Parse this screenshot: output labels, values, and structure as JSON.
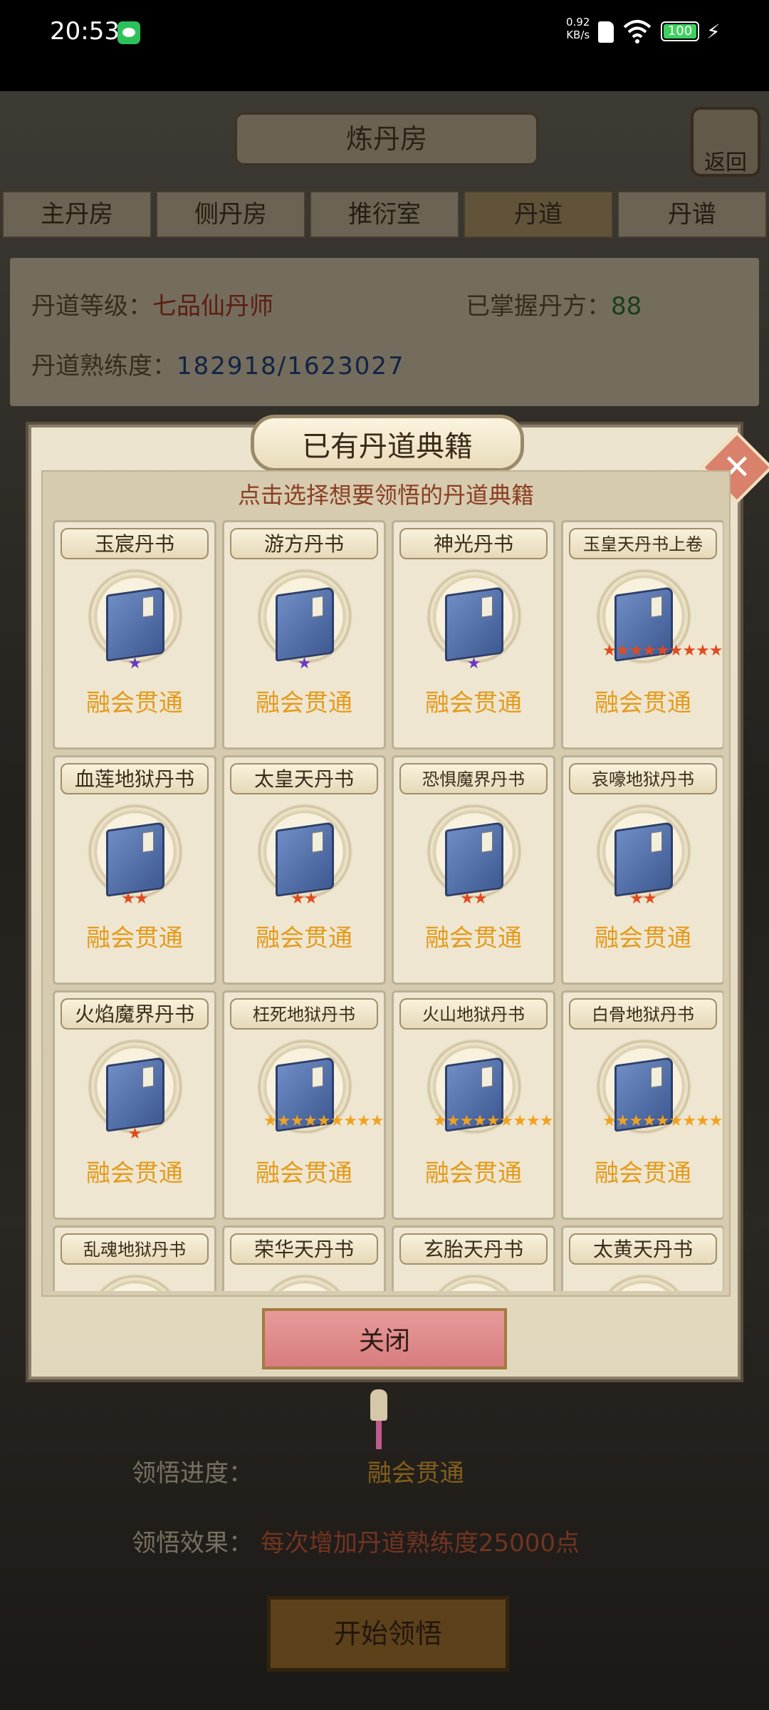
{
  "status_bar": {
    "time": "20:53",
    "net_speed_value": "0.92",
    "net_speed_unit": "KB/s",
    "battery": "100"
  },
  "background": {
    "title": "炼丹房",
    "back_label": "返回",
    "tabs": [
      {
        "label": "主丹房",
        "active": false
      },
      {
        "label": "侧丹房",
        "active": false
      },
      {
        "label": "推衍室",
        "active": false
      },
      {
        "label": "丹道",
        "active": true
      },
      {
        "label": "丹谱",
        "active": false
      }
    ],
    "info": {
      "level_label": "丹道等级：",
      "level_value": "七品仙丹师",
      "mastered_label": "已掌握丹方：",
      "mastered_value": "88",
      "proficiency_label": "丹道熟练度：",
      "proficiency_value": "182918/1623027"
    },
    "progress_label": "领悟进度：",
    "progress_value": "融会贯通",
    "effect_label": "领悟效果：",
    "effect_value": "每次增加丹道熟练度25000点",
    "start_button": "开始领悟"
  },
  "dialog": {
    "title": "已有丹道典籍",
    "subtitle": "点击选择想要领悟的丹道典籍",
    "close_button": "关闭",
    "books": [
      {
        "name": "玉宸丹书",
        "stars": "★",
        "star_color": "purple",
        "status": "融会贯通"
      },
      {
        "name": "游方丹书",
        "stars": "★",
        "star_color": "purple",
        "status": "融会贯通"
      },
      {
        "name": "神光丹书",
        "stars": "★",
        "star_color": "purple",
        "status": "融会贯通"
      },
      {
        "name": "玉皇天丹书上卷",
        "stars": "★★★★★★★★★",
        "star_color": "red",
        "status": "融会贯通"
      },
      {
        "name": "血莲地狱丹书",
        "stars": "★★",
        "star_color": "red",
        "status": "融会贯通"
      },
      {
        "name": "太皇天丹书",
        "stars": "★★",
        "star_color": "red",
        "status": "融会贯通"
      },
      {
        "name": "恐惧魔界丹书",
        "stars": "★★",
        "star_color": "red",
        "status": "融会贯通"
      },
      {
        "name": "哀嚎地狱丹书",
        "stars": "★★",
        "star_color": "red",
        "status": "融会贯通"
      },
      {
        "name": "火焰魔界丹书",
        "stars": "★",
        "star_color": "red",
        "status": "融会贯通"
      },
      {
        "name": "枉死地狱丹书",
        "stars": "★★★★★★★★★",
        "star_color": "gold",
        "status": "融会贯通"
      },
      {
        "name": "火山地狱丹书",
        "stars": "★★★★★★★★★",
        "star_color": "gold",
        "status": "融会贯通"
      },
      {
        "name": "白骨地狱丹书",
        "stars": "★★★★★★★★★",
        "star_color": "gold",
        "status": "融会贯通"
      },
      {
        "name": "乱魂地狱丹书",
        "stars": "",
        "star_color": "gold",
        "status": ""
      },
      {
        "name": "荣华天丹书",
        "stars": "",
        "star_color": "gold",
        "status": ""
      },
      {
        "name": "玄胎天丹书",
        "stars": "",
        "star_color": "gold",
        "status": ""
      },
      {
        "name": "太黄天丹书",
        "stars": "",
        "star_color": "gold",
        "status": ""
      }
    ]
  }
}
